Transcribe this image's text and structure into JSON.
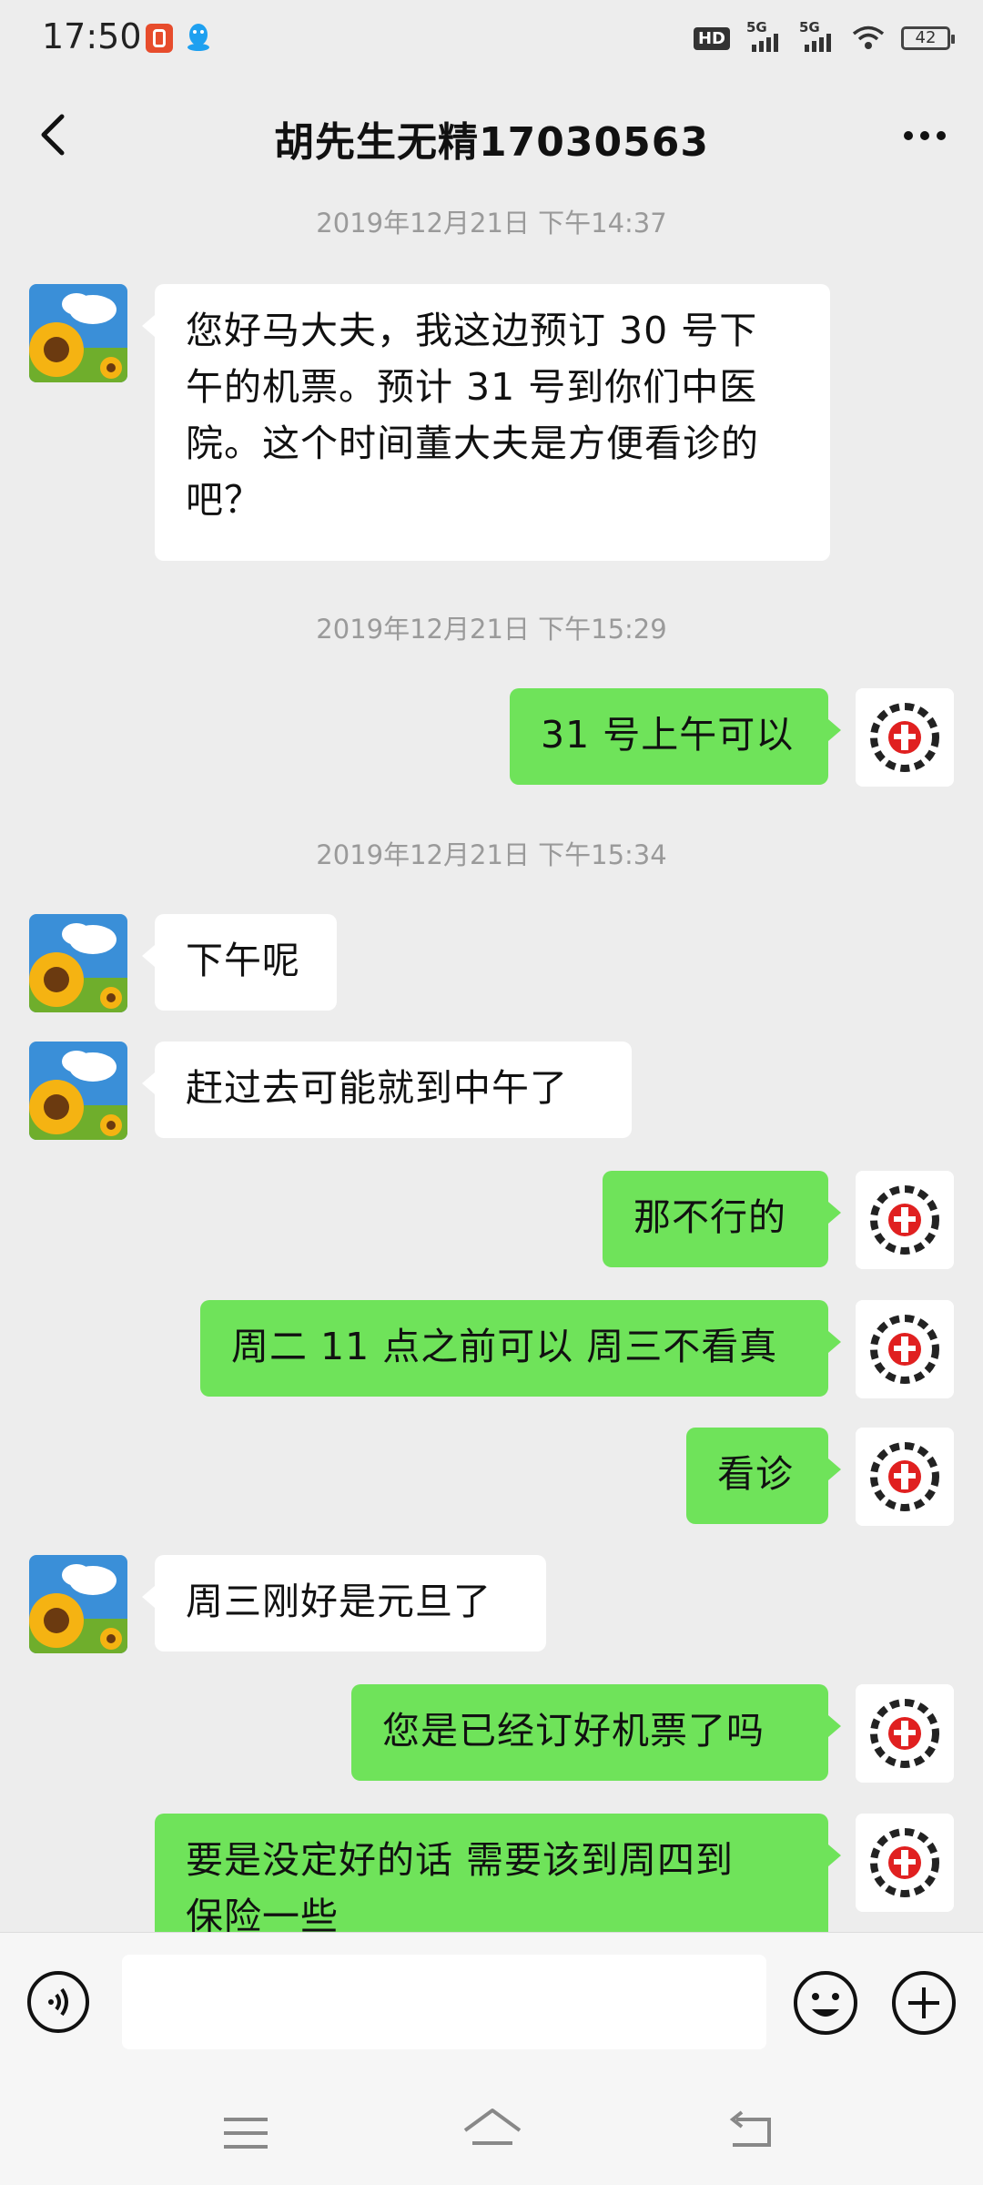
{
  "status_bar": {
    "time": "17:50",
    "hd_label": "HD",
    "network_1": "5G",
    "network_2": "5G",
    "battery": "42"
  },
  "header": {
    "title": "胡先生无精17030563"
  },
  "messages": [
    {
      "type": "timestamp",
      "text": "2019年12月21日 下午14:37"
    },
    {
      "type": "in",
      "text": "您好马大夫，我这边预订 30 号下\n午的机票。预计 31 号到你们中医\n院。这个时间董大夫是方便看诊的\n吧？"
    },
    {
      "type": "timestamp",
      "text": "2019年12月21日 下午15:29"
    },
    {
      "type": "out",
      "text": "31 号上午可以"
    },
    {
      "type": "timestamp",
      "text": "2019年12月21日 下午15:34"
    },
    {
      "type": "in",
      "text": "下午呢"
    },
    {
      "type": "in",
      "text": "赶过去可能就到中午了"
    },
    {
      "type": "out",
      "text": "那不行的"
    },
    {
      "type": "out",
      "text": "周二 11 点之前可以 周三不看真"
    },
    {
      "type": "out",
      "text": "看诊"
    },
    {
      "type": "in",
      "text": "周三刚好是元旦了"
    },
    {
      "type": "out",
      "text": "您是已经订好机票了吗"
    },
    {
      "type": "out",
      "text": "要是没定好的话 需要该到周四到\n保险一些"
    }
  ],
  "input": {
    "value": ""
  },
  "colors": {
    "background": "#ededed",
    "outgoing_bubble": "#6fe35a",
    "incoming_bubble": "#ffffff"
  },
  "icons": {
    "back": "chevron-left-icon",
    "more": "more-dots-icon",
    "voice": "voice-icon",
    "emoji": "emoji-icon",
    "plus": "plus-icon"
  }
}
